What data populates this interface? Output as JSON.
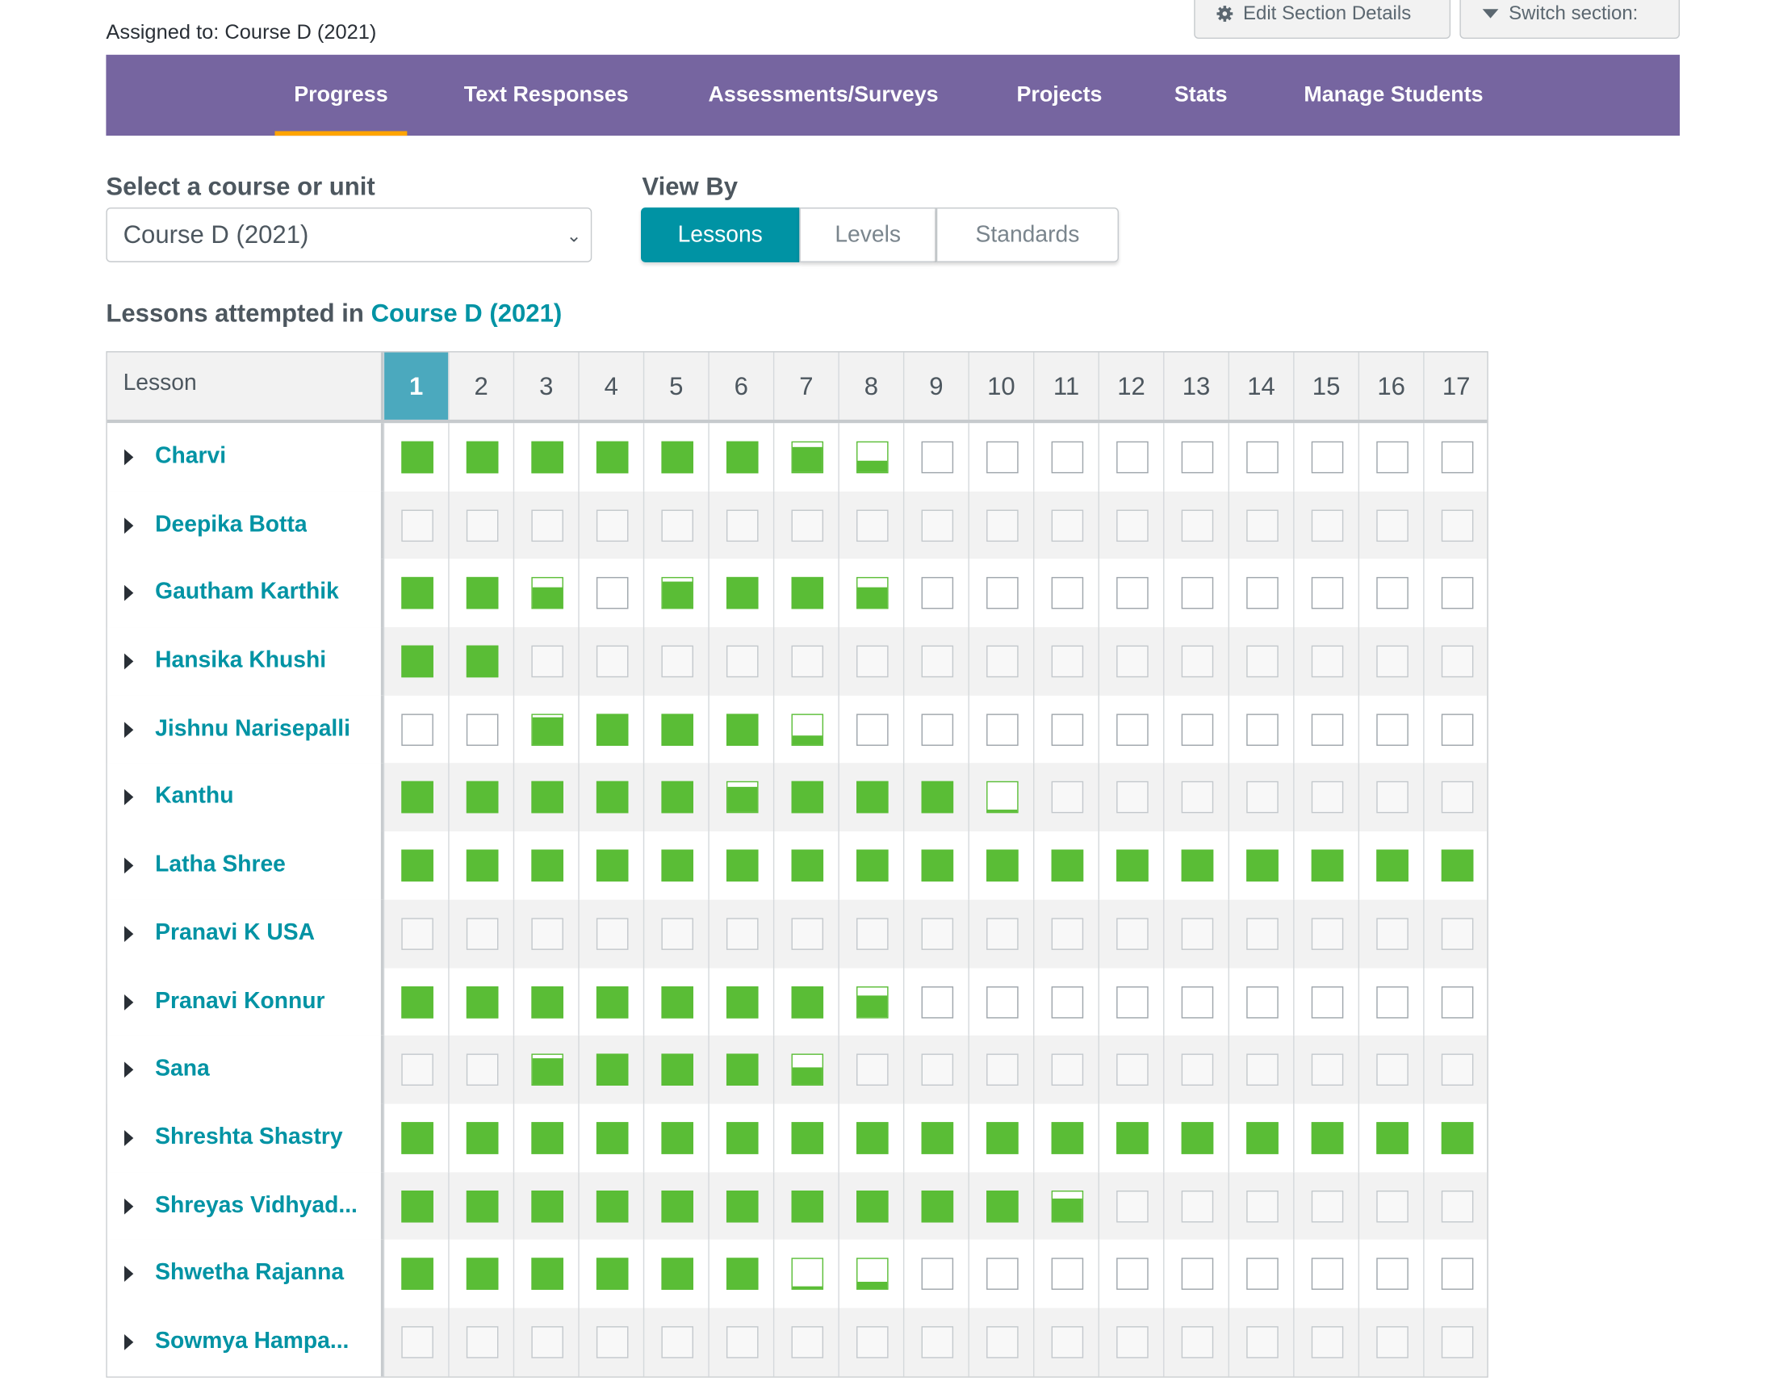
{
  "header": {
    "assigned_to": "Assigned to: Course D (2021)",
    "edit_button": "Edit Section Details",
    "switch_button": "Switch section:"
  },
  "nav": {
    "tabs": [
      {
        "label": "Progress",
        "active": true
      },
      {
        "label": "Text Responses"
      },
      {
        "label": "Assessments/Surveys"
      },
      {
        "label": "Projects"
      },
      {
        "label": "Stats"
      },
      {
        "label": "Manage Students"
      }
    ]
  },
  "course_select": {
    "label": "Select a course or unit",
    "value": "Course D (2021)"
  },
  "view_by": {
    "label": "View By",
    "options": [
      "Lessons",
      "Levels",
      "Standards"
    ],
    "selected": "Lessons"
  },
  "caption": {
    "prefix": "Lessons attempted in ",
    "course": "Course D (2021)"
  },
  "table": {
    "first_header": "Lesson",
    "lessons": [
      "1",
      "2",
      "3",
      "4",
      "5",
      "6",
      "7",
      "8",
      "9",
      "10",
      "11",
      "12",
      "13",
      "14",
      "15",
      "16",
      "17"
    ],
    "active_lesson": "1",
    "students": [
      {
        "name": "Charvi",
        "progress": [
          1,
          1,
          1,
          1,
          1,
          1,
          0.85,
          0.4,
          0,
          0,
          0,
          0,
          0,
          0,
          0,
          0,
          0
        ]
      },
      {
        "name": "Deepika Botta",
        "progress": [
          0,
          0,
          0,
          0,
          0,
          0,
          0,
          0,
          0,
          0,
          0,
          0,
          0,
          0,
          0,
          0,
          0
        ]
      },
      {
        "name": "Gautham Karthik",
        "progress": [
          1,
          1,
          0.7,
          0,
          0.9,
          1,
          1,
          0.7,
          0,
          0,
          0,
          0,
          0,
          0,
          0,
          0,
          0
        ]
      },
      {
        "name": "Hansika Khushi",
        "progress": [
          1,
          1,
          0,
          0,
          0,
          0,
          0,
          0,
          0,
          0,
          0,
          0,
          0,
          0,
          0,
          0,
          0
        ]
      },
      {
        "name": "Jishnu Narisepalli",
        "progress": [
          0,
          0,
          0.9,
          1,
          1,
          1,
          0.3,
          0,
          0,
          0,
          0,
          0,
          0,
          0,
          0,
          0,
          0
        ]
      },
      {
        "name": "Kanthu",
        "progress": [
          1,
          1,
          1,
          1,
          1,
          0.85,
          1,
          1,
          1,
          0.1,
          0,
          0,
          0,
          0,
          0,
          0,
          0
        ]
      },
      {
        "name": "Latha Shree",
        "progress": [
          1,
          1,
          1,
          1,
          1,
          1,
          1,
          1,
          1,
          1,
          1,
          1,
          1,
          1,
          1,
          1,
          1
        ]
      },
      {
        "name": "Pranavi K USA",
        "progress": [
          0,
          0,
          0,
          0,
          0,
          0,
          0,
          0,
          0,
          0,
          0,
          0,
          0,
          0,
          0,
          0,
          0
        ]
      },
      {
        "name": "Pranavi Konnur",
        "progress": [
          1,
          1,
          1,
          1,
          1,
          1,
          1,
          0.7,
          0,
          0,
          0,
          0,
          0,
          0,
          0,
          0,
          0
        ]
      },
      {
        "name": "Sana",
        "progress": [
          0,
          0,
          0.9,
          1,
          1,
          1,
          0.6,
          0,
          0,
          0,
          0,
          0,
          0,
          0,
          0,
          0,
          0
        ]
      },
      {
        "name": "Shreshta Shastry",
        "progress": [
          1,
          1,
          1,
          1,
          1,
          1,
          1,
          1,
          1,
          1,
          1,
          1,
          1,
          1,
          1,
          1,
          1
        ]
      },
      {
        "name": "Shreyas Vidhyad...",
        "progress": [
          1,
          1,
          1,
          1,
          1,
          1,
          1,
          1,
          1,
          1,
          0.75,
          0,
          0,
          0,
          0,
          0,
          0
        ]
      },
      {
        "name": "Shwetha Rajanna",
        "progress": [
          1,
          1,
          1,
          1,
          1,
          1,
          0.1,
          0.25,
          0,
          0,
          0,
          0,
          0,
          0,
          0,
          0,
          0
        ]
      },
      {
        "name": "Sowmya Hampa...",
        "progress": [
          0,
          0,
          0,
          0,
          0,
          0,
          0,
          0,
          0,
          0,
          0,
          0,
          0,
          0,
          0,
          0,
          0
        ]
      }
    ]
  },
  "colors": {
    "nav_bg": "#7665a0",
    "accent_teal": "#0093a4",
    "progress_green": "#5abd36",
    "active_tab_underline": "#ffa400"
  }
}
